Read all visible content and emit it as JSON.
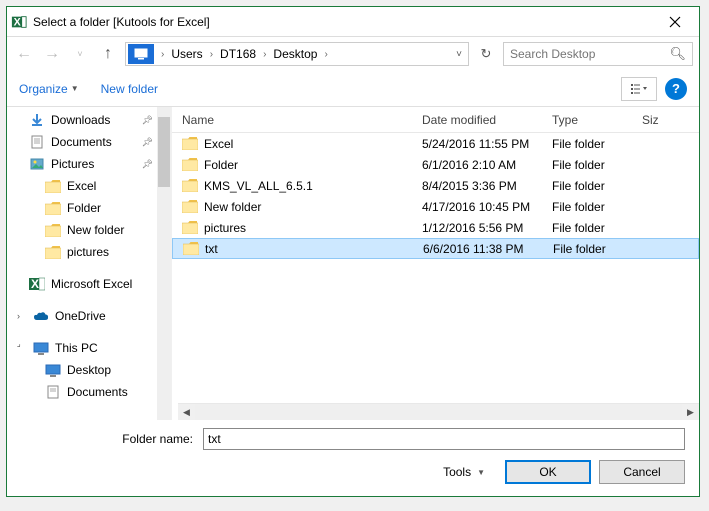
{
  "title": "Select a folder [Kutools for Excel]",
  "breadcrumb": {
    "items": [
      "Users",
      "DT168",
      "Desktop"
    ]
  },
  "search": {
    "placeholder": "Search Desktop"
  },
  "toolbar": {
    "organize": "Organize",
    "newfolder": "New folder"
  },
  "sidebar": {
    "items": [
      {
        "label": "Downloads",
        "icon": "download",
        "pin": true
      },
      {
        "label": "Documents",
        "icon": "doc",
        "pin": true
      },
      {
        "label": "Pictures",
        "icon": "pic",
        "pin": true
      },
      {
        "label": "Excel",
        "icon": "folder",
        "indent": true
      },
      {
        "label": "Folder",
        "icon": "folder",
        "indent": true
      },
      {
        "label": "New folder",
        "icon": "folder",
        "indent": true
      },
      {
        "label": "pictures",
        "icon": "folder",
        "indent": true
      }
    ],
    "excel": "Microsoft Excel",
    "onedrive": "OneDrive",
    "thispc": "This PC",
    "desktop": "Desktop",
    "documents": "Documents"
  },
  "columns": {
    "name": "Name",
    "date": "Date modified",
    "type": "Type",
    "size": "Siz"
  },
  "files": [
    {
      "name": "Excel",
      "date": "5/24/2016 11:55 PM",
      "type": "File folder"
    },
    {
      "name": "Folder",
      "date": "6/1/2016 2:10 AM",
      "type": "File folder"
    },
    {
      "name": "KMS_VL_ALL_6.5.1",
      "date": "8/4/2015 3:36 PM",
      "type": "File folder"
    },
    {
      "name": "New folder",
      "date": "4/17/2016 10:45 PM",
      "type": "File folder"
    },
    {
      "name": "pictures",
      "date": "1/12/2016 5:56 PM",
      "type": "File folder"
    },
    {
      "name": "txt",
      "date": "6/6/2016 11:38 PM",
      "type": "File folder",
      "selected": true
    }
  ],
  "foldername": {
    "label": "Folder name:",
    "value": "txt"
  },
  "buttons": {
    "tools": "Tools",
    "ok": "OK",
    "cancel": "Cancel"
  }
}
